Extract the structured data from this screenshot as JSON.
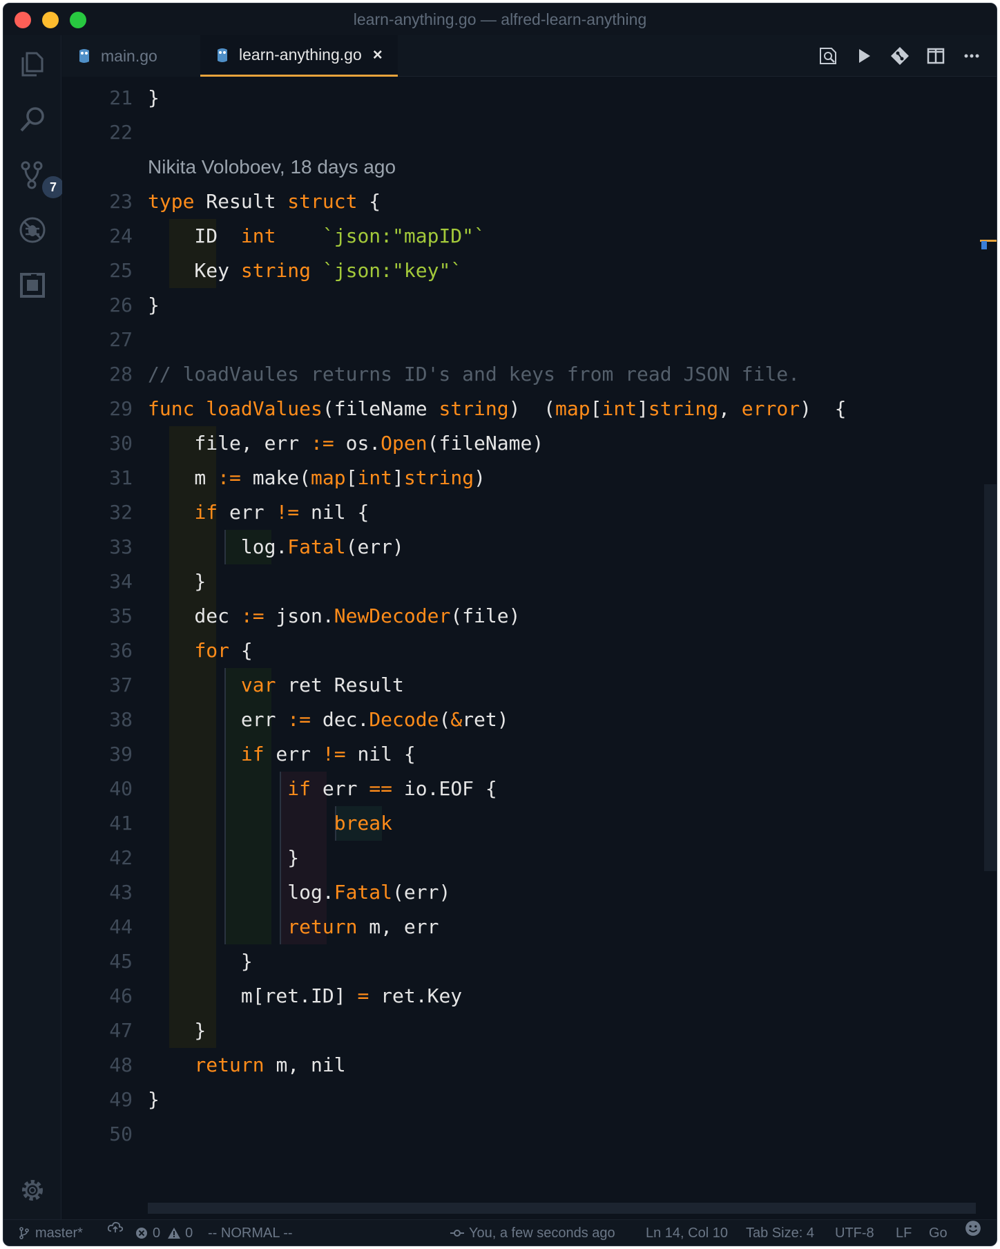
{
  "window": {
    "title": "learn-anything.go — alfred-learn-anything"
  },
  "activity_bar": {
    "items": [
      {
        "name": "explorer",
        "icon": "files-icon"
      },
      {
        "name": "search",
        "icon": "search-icon"
      },
      {
        "name": "source-control",
        "icon": "source-control-icon",
        "badge": "7"
      },
      {
        "name": "debug",
        "icon": "debug-icon"
      },
      {
        "name": "extensions",
        "icon": "extensions-icon"
      }
    ],
    "settings_icon": "gear-icon"
  },
  "tabs": [
    {
      "label": "main.go",
      "icon": "gopher-icon",
      "active": false
    },
    {
      "label": "learn-anything.go",
      "icon": "gopher-icon",
      "active": true,
      "close": "×"
    }
  ],
  "toolbar": {
    "icons": [
      "open-changes-icon",
      "run-icon",
      "git-compare-icon",
      "split-editor-icon",
      "more-icon"
    ]
  },
  "editor": {
    "blame": "Nikita Voloboev, 18 days ago",
    "lines": [
      {
        "n": "21",
        "tokens": [
          {
            "t": "}",
            "c": "p"
          }
        ]
      },
      {
        "n": "22",
        "tokens": []
      },
      {
        "n": "23",
        "tokens": [
          {
            "t": "type",
            "c": "k"
          },
          {
            "t": " Result ",
            "c": "p"
          },
          {
            "t": "struct",
            "c": "k"
          },
          {
            "t": " {",
            "c": "p"
          }
        ]
      },
      {
        "n": "24",
        "tokens": [
          {
            "t": "    ID  ",
            "c": "p"
          },
          {
            "t": "int",
            "c": "k"
          },
          {
            "t": "    ",
            "c": "p"
          },
          {
            "t": "`json:\"mapID\"`",
            "c": "s"
          }
        ]
      },
      {
        "n": "25",
        "tokens": [
          {
            "t": "    Key ",
            "c": "p"
          },
          {
            "t": "string",
            "c": "k"
          },
          {
            "t": " ",
            "c": "p"
          },
          {
            "t": "`json:\"key\"`",
            "c": "s"
          }
        ]
      },
      {
        "n": "26",
        "tokens": [
          {
            "t": "}",
            "c": "p"
          }
        ]
      },
      {
        "n": "27",
        "tokens": []
      },
      {
        "n": "28",
        "tokens": [
          {
            "t": "// loadVaules returns ID's and keys from read JSON file.",
            "c": "c"
          }
        ]
      },
      {
        "n": "29",
        "tokens": [
          {
            "t": "func",
            "c": "k"
          },
          {
            "t": " ",
            "c": "p"
          },
          {
            "t": "loadValues",
            "c": "k"
          },
          {
            "t": "(fileName ",
            "c": "p"
          },
          {
            "t": "string",
            "c": "k"
          },
          {
            "t": ")  (",
            "c": "p"
          },
          {
            "t": "map",
            "c": "k"
          },
          {
            "t": "[",
            "c": "p"
          },
          {
            "t": "int",
            "c": "k"
          },
          {
            "t": "]",
            "c": "p"
          },
          {
            "t": "string",
            "c": "k"
          },
          {
            "t": ", ",
            "c": "p"
          },
          {
            "t": "error",
            "c": "k"
          },
          {
            "t": ")  {",
            "c": "p"
          }
        ]
      },
      {
        "n": "30",
        "tokens": [
          {
            "t": "    file, err ",
            "c": "p"
          },
          {
            "t": ":=",
            "c": "k"
          },
          {
            "t": " os.",
            "c": "p"
          },
          {
            "t": "Open",
            "c": "k"
          },
          {
            "t": "(fileName)",
            "c": "p"
          }
        ]
      },
      {
        "n": "31",
        "tokens": [
          {
            "t": "    m ",
            "c": "p"
          },
          {
            "t": ":=",
            "c": "k"
          },
          {
            "t": " make(",
            "c": "p"
          },
          {
            "t": "map",
            "c": "k"
          },
          {
            "t": "[",
            "c": "p"
          },
          {
            "t": "int",
            "c": "k"
          },
          {
            "t": "]",
            "c": "p"
          },
          {
            "t": "string",
            "c": "k"
          },
          {
            "t": ")",
            "c": "p"
          }
        ]
      },
      {
        "n": "32",
        "tokens": [
          {
            "t": "    ",
            "c": "p"
          },
          {
            "t": "if",
            "c": "k"
          },
          {
            "t": " err ",
            "c": "p"
          },
          {
            "t": "!=",
            "c": "k"
          },
          {
            "t": " nil {",
            "c": "p"
          }
        ]
      },
      {
        "n": "33",
        "tokens": [
          {
            "t": "        log.",
            "c": "p"
          },
          {
            "t": "Fatal",
            "c": "k"
          },
          {
            "t": "(err)",
            "c": "p"
          }
        ]
      },
      {
        "n": "34",
        "tokens": [
          {
            "t": "    }",
            "c": "p"
          }
        ]
      },
      {
        "n": "35",
        "tokens": [
          {
            "t": "    dec ",
            "c": "p"
          },
          {
            "t": ":=",
            "c": "k"
          },
          {
            "t": " json.",
            "c": "p"
          },
          {
            "t": "NewDecoder",
            "c": "k"
          },
          {
            "t": "(file)",
            "c": "p"
          }
        ]
      },
      {
        "n": "36",
        "tokens": [
          {
            "t": "    ",
            "c": "p"
          },
          {
            "t": "for",
            "c": "k"
          },
          {
            "t": " {",
            "c": "p"
          }
        ]
      },
      {
        "n": "37",
        "tokens": [
          {
            "t": "        ",
            "c": "p"
          },
          {
            "t": "var",
            "c": "k"
          },
          {
            "t": " ret Result",
            "c": "p"
          }
        ]
      },
      {
        "n": "38",
        "tokens": [
          {
            "t": "        err ",
            "c": "p"
          },
          {
            "t": ":=",
            "c": "k"
          },
          {
            "t": " dec.",
            "c": "p"
          },
          {
            "t": "Decode",
            "c": "k"
          },
          {
            "t": "(",
            "c": "p"
          },
          {
            "t": "&",
            "c": "k"
          },
          {
            "t": "ret)",
            "c": "p"
          }
        ]
      },
      {
        "n": "39",
        "tokens": [
          {
            "t": "        ",
            "c": "p"
          },
          {
            "t": "if",
            "c": "k"
          },
          {
            "t": " err ",
            "c": "p"
          },
          {
            "t": "!=",
            "c": "k"
          },
          {
            "t": " nil {",
            "c": "p"
          }
        ]
      },
      {
        "n": "40",
        "tokens": [
          {
            "t": "            ",
            "c": "p"
          },
          {
            "t": "if",
            "c": "k"
          },
          {
            "t": " err ",
            "c": "p"
          },
          {
            "t": "==",
            "c": "k"
          },
          {
            "t": " io.EOF {",
            "c": "p"
          }
        ]
      },
      {
        "n": "41",
        "tokens": [
          {
            "t": "                ",
            "c": "p"
          },
          {
            "t": "break",
            "c": "k"
          }
        ]
      },
      {
        "n": "42",
        "tokens": [
          {
            "t": "            }",
            "c": "p"
          }
        ]
      },
      {
        "n": "43",
        "tokens": [
          {
            "t": "            log.",
            "c": "p"
          },
          {
            "t": "Fatal",
            "c": "k"
          },
          {
            "t": "(err)",
            "c": "p"
          }
        ]
      },
      {
        "n": "44",
        "tokens": [
          {
            "t": "            ",
            "c": "p"
          },
          {
            "t": "return",
            "c": "k"
          },
          {
            "t": " m, err",
            "c": "p"
          }
        ]
      },
      {
        "n": "45",
        "tokens": [
          {
            "t": "        }",
            "c": "p"
          }
        ]
      },
      {
        "n": "46",
        "tokens": [
          {
            "t": "        m[ret.ID] ",
            "c": "p"
          },
          {
            "t": "=",
            "c": "k"
          },
          {
            "t": " ret.Key",
            "c": "p"
          }
        ]
      },
      {
        "n": "47",
        "tokens": [
          {
            "t": "    }",
            "c": "p"
          }
        ]
      },
      {
        "n": "48",
        "tokens": [
          {
            "t": "    ",
            "c": "p"
          },
          {
            "t": "return",
            "c": "k"
          },
          {
            "t": " m, nil",
            "c": "p"
          }
        ]
      },
      {
        "n": "49",
        "tokens": [
          {
            "t": "}",
            "c": "p"
          }
        ]
      },
      {
        "n": "50",
        "tokens": []
      }
    ]
  },
  "statusbar": {
    "branch": "master*",
    "branch_icon": "git-branch-icon",
    "sync_icon": "cloud-sync-icon",
    "errors": "0",
    "warnings": "0",
    "vim_mode": "-- NORMAL --",
    "blame": "You, a few seconds ago",
    "cursor": "Ln 14, Col 10",
    "tab_size": "Tab Size: 4",
    "encoding": "UTF-8",
    "eol": "LF",
    "language": "Go",
    "feedback_icon": "smiley-icon"
  },
  "colors": {
    "keyword": "#ff8c1a",
    "string": "#a3c93a",
    "comment": "#545f6b",
    "plain": "#e5e5e5",
    "background": "#0d131c",
    "accent": "#e8a33c"
  }
}
